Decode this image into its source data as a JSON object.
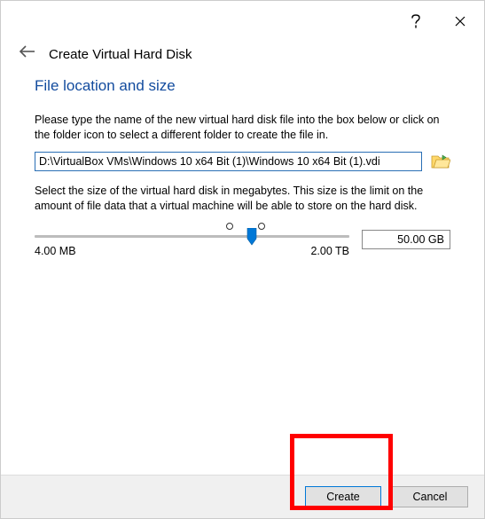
{
  "titlebar": {
    "help_tooltip": "?",
    "close_tooltip": "Close"
  },
  "header": {
    "wizard_title": "Create Virtual Hard Disk"
  },
  "section": {
    "title": "File location and size",
    "path_desc": "Please type the name of the new virtual hard disk file into the box below or click on the folder icon to select a different folder to create the file in.",
    "path_value": "D:\\VirtualBox VMs\\Windows 10 x64 Bit (1)\\Windows 10 x64 Bit (1).vdi",
    "size_desc": "Select the size of the virtual hard disk in megabytes. This size is the limit on the amount of file data that a virtual machine will be able to store on the hard disk.",
    "size_display": "50.00 GB",
    "slider_min_label": "4.00 MB",
    "slider_max_label": "2.00 TB"
  },
  "buttons": {
    "create": "Create",
    "cancel": "Cancel"
  }
}
